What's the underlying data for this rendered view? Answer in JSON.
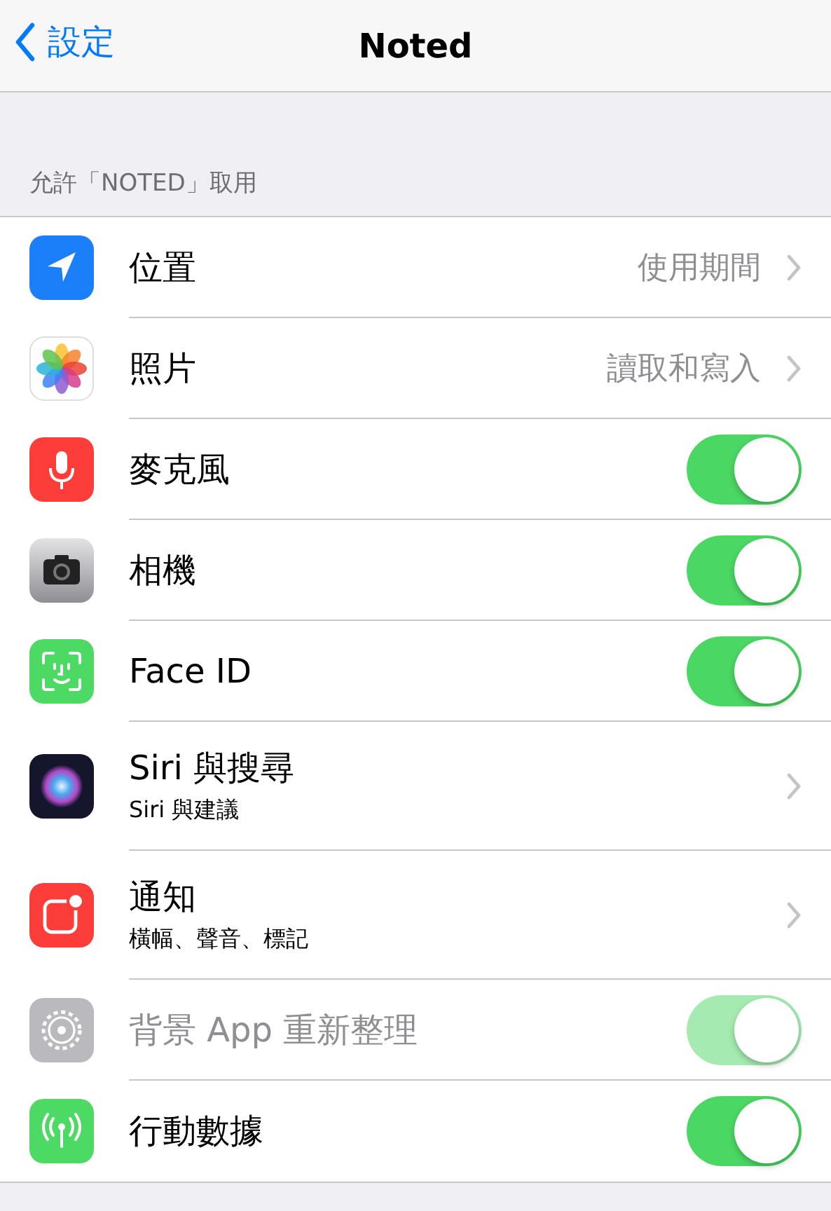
{
  "nav": {
    "back": "設定",
    "title": "Noted"
  },
  "section_header": "允許「NOTED」取用",
  "rows": [
    {
      "kind": "link",
      "label": "位置",
      "value": "使用期間"
    },
    {
      "kind": "link",
      "label": "照片",
      "value": "讀取和寫入"
    },
    {
      "kind": "toggle",
      "label": "麥克風",
      "on": true,
      "disabled": false
    },
    {
      "kind": "toggle",
      "label": "相機",
      "on": true,
      "disabled": false
    },
    {
      "kind": "toggle",
      "label": "Face ID",
      "on": true,
      "disabled": false
    },
    {
      "kind": "link",
      "label": "Siri 與搜尋",
      "subtitle": "Siri 與建議"
    },
    {
      "kind": "link",
      "label": "通知",
      "subtitle": "橫幅、聲音、標記"
    },
    {
      "kind": "toggle",
      "label": "背景 App 重新整理",
      "on": true,
      "disabled": true
    },
    {
      "kind": "toggle",
      "label": "行動數據",
      "on": true,
      "disabled": false
    }
  ]
}
